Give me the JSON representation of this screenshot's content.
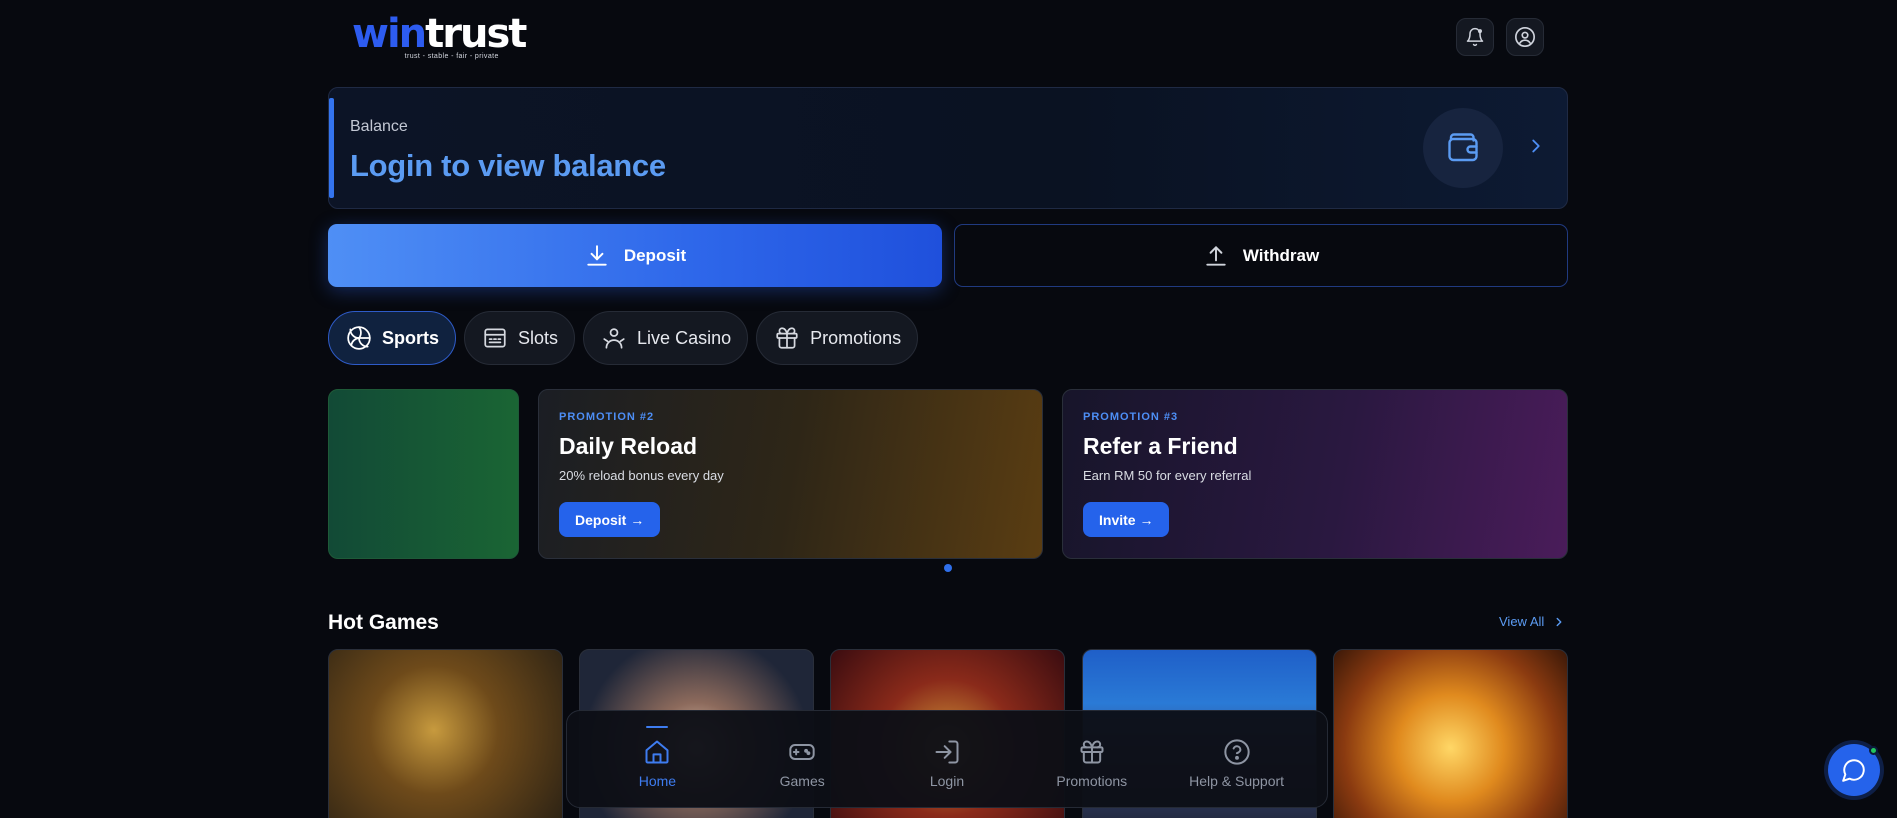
{
  "brand": {
    "win": "win",
    "trust": "trust",
    "tagline": "trust - stable - fair - private"
  },
  "header": {
    "icons": [
      "bell-icon",
      "user-circle-icon"
    ]
  },
  "balance": {
    "label": "Balance",
    "value": "Login to view balance"
  },
  "actions": {
    "deposit_label": "Deposit",
    "withdraw_label": "Withdraw"
  },
  "categories": [
    {
      "label": "Sports",
      "icon": "volleyball-icon",
      "active": true
    },
    {
      "label": "Slots",
      "icon": "slot-machine-icon",
      "active": false
    },
    {
      "label": "Live Casino",
      "icon": "dealer-icon",
      "active": false
    },
    {
      "label": "Promotions",
      "icon": "gift-icon",
      "active": false
    }
  ],
  "promotions": [
    {
      "tag": "PROMOTION #2",
      "title": "Daily Reload",
      "desc": "20% reload bonus every day",
      "button": "Deposit →"
    },
    {
      "tag": "PROMOTION #3",
      "title": "Refer a Friend",
      "desc": "Earn RM 50 for every referral",
      "button": "Invite →"
    }
  ],
  "hot_games": {
    "title": "Hot Games",
    "view_all": "View All"
  },
  "bottom_nav": [
    {
      "label": "Home",
      "icon": "home-icon",
      "active": true
    },
    {
      "label": "Games",
      "icon": "gamepad-icon",
      "active": false
    },
    {
      "label": "Login",
      "icon": "login-icon",
      "active": false
    },
    {
      "label": "Promotions",
      "icon": "gift-icon",
      "active": false
    },
    {
      "label": "Help & Support",
      "icon": "help-circle-icon",
      "active": false
    }
  ],
  "colors": {
    "accent": "#2563eb",
    "balance_text": "#5b9bf2",
    "background": "#07090f"
  }
}
